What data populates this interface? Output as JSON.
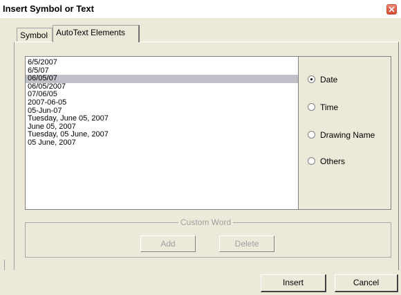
{
  "window": {
    "title": "Insert Symbol or Text"
  },
  "tabs": [
    {
      "label": "Symbol",
      "active": false
    },
    {
      "label": "AutoText Elements",
      "active": true
    }
  ],
  "date_formats": {
    "items": [
      "6/5/2007",
      "6/5/07",
      "06/05/07",
      "06/05/2007",
      "07/06/05",
      "2007-06-05",
      "05-Jun-07",
      "Tuesday, June 05, 2007",
      "June 05, 2007",
      "Tuesday, 05 June, 2007",
      "05 June, 2007"
    ],
    "selected_index": 2
  },
  "categories": {
    "options": [
      "Date",
      "Time",
      "Drawing Name",
      "Others"
    ],
    "selected": "Date"
  },
  "custom_word": {
    "title": "Custom Word",
    "add_label": "Add",
    "delete_label": "Delete"
  },
  "footer": {
    "insert_label": "Insert",
    "cancel_label": "Cancel"
  },
  "colors": {
    "dialog_bg": "#ece9d8",
    "selection": "#c0c0c8",
    "close_button": "#d3472d"
  }
}
